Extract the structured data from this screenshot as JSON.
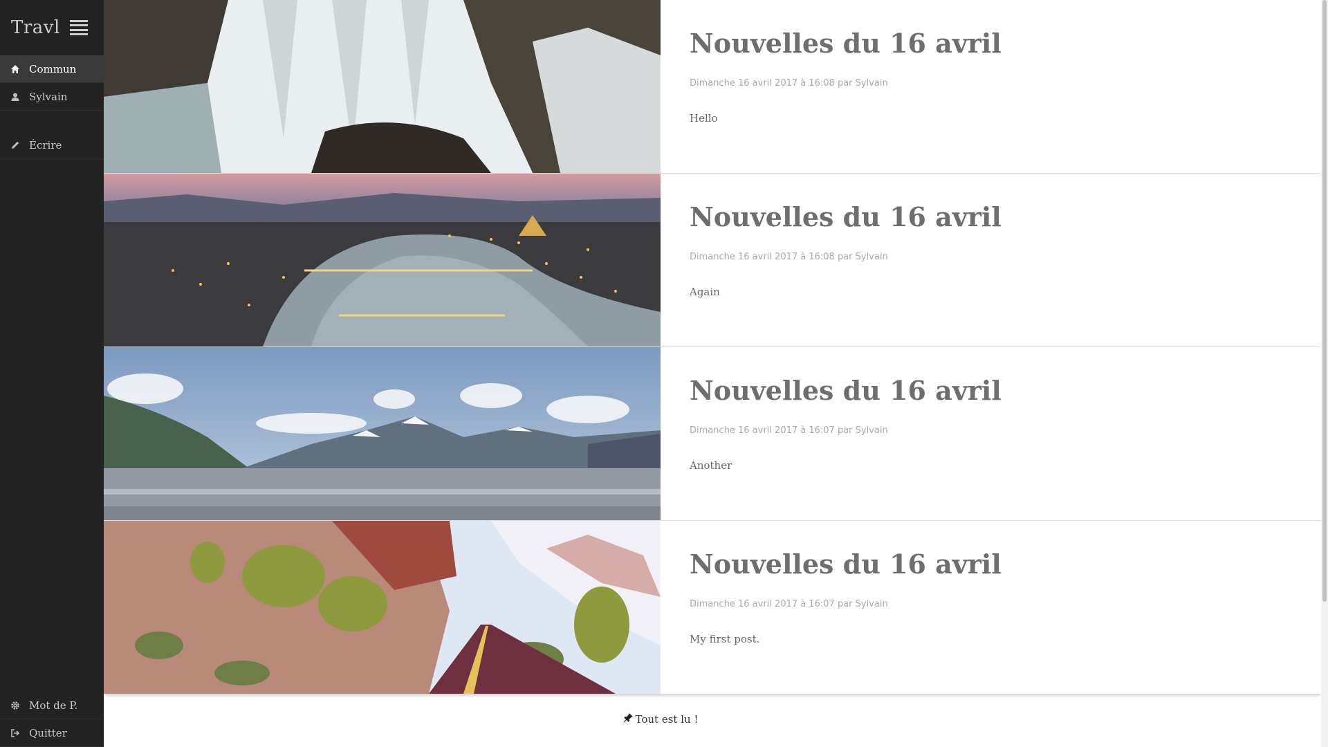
{
  "app": {
    "brand": "Travl"
  },
  "sidebar": {
    "items": [
      {
        "label": "Commun",
        "icon": "home-icon",
        "active": true
      },
      {
        "label": "Sylvain",
        "icon": "user-icon",
        "active": false
      },
      {
        "label": "Écrire",
        "icon": "pencil-icon",
        "active": false
      }
    ],
    "bottom_items": [
      {
        "label": "Mot de P.",
        "icon": "gear-icon"
      },
      {
        "label": "Quitter",
        "icon": "logout-icon"
      }
    ]
  },
  "posts": [
    {
      "title": "Nouvelles du 16 avril",
      "meta": "Dimanche 16 avril 2017 à 16:08 par Sylvain",
      "text": "Hello",
      "image": "waterfall"
    },
    {
      "title": "Nouvelles du 16 avril",
      "meta": "Dimanche 16 avril 2017 à 16:08 par Sylvain",
      "text": "Again",
      "image": "city-river-night"
    },
    {
      "title": "Nouvelles du 16 avril",
      "meta": "Dimanche 16 avril 2017 à 16:07 par Sylvain",
      "text": "Another",
      "image": "mountain-lake"
    },
    {
      "title": "Nouvelles du 16 avril",
      "meta": "Dimanche 16 avril 2017 à 16:07 par Sylvain",
      "text": "My first post.",
      "image": "canyon-road"
    }
  ],
  "footer": {
    "status": "Tout est lu !",
    "icon": "pin-icon"
  }
}
